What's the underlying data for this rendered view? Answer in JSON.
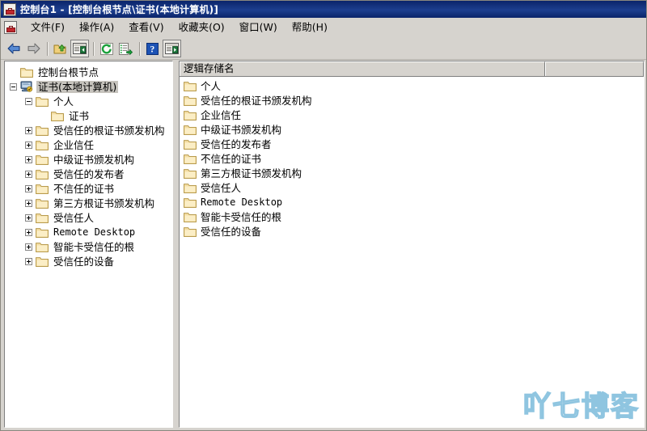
{
  "window": {
    "title": "控制台1 - [控制台根节点\\证书(本地计算机)]",
    "icon": "mmc-console-icon",
    "titlebar_color": "#0a246a",
    "chrome_color": "#d6d3ce"
  },
  "menu": {
    "items": [
      {
        "label": "文件(F)",
        "name": "menu-file"
      },
      {
        "label": "操作(A)",
        "name": "menu-action"
      },
      {
        "label": "查看(V)",
        "name": "menu-view"
      },
      {
        "label": "收藏夹(O)",
        "name": "menu-favorites"
      },
      {
        "label": "窗口(W)",
        "name": "menu-window"
      },
      {
        "label": "帮助(H)",
        "name": "menu-help"
      }
    ]
  },
  "toolbar": {
    "buttons": [
      {
        "icon": "back-arrow-icon",
        "enabled": true
      },
      {
        "icon": "forward-arrow-icon",
        "enabled": false
      },
      {
        "icon": "up-one-level-folder-icon",
        "enabled": true
      },
      {
        "icon": "show-hide-console-tree-icon",
        "enabled": true
      },
      {
        "icon": "refresh-icon",
        "enabled": true
      },
      {
        "icon": "export-list-icon",
        "enabled": true
      },
      {
        "icon": "help-icon",
        "enabled": true
      },
      {
        "icon": "properties-view-icon",
        "enabled": true
      }
    ]
  },
  "tree": {
    "nodes": [
      {
        "label": "控制台根节点",
        "depth": 0,
        "expander": "none",
        "icon": "folder-icon",
        "selected": false
      },
      {
        "label": "证书(本地计算机)",
        "depth": 0,
        "expander": "minus",
        "icon": "certificates-computer-icon",
        "selected": true
      },
      {
        "label": "个人",
        "depth": 1,
        "expander": "minus",
        "icon": "folder-icon",
        "selected": false
      },
      {
        "label": "证书",
        "depth": 2,
        "expander": "none",
        "icon": "folder-icon",
        "selected": false
      },
      {
        "label": "受信任的根证书颁发机构",
        "depth": 1,
        "expander": "plus",
        "icon": "folder-icon",
        "selected": false
      },
      {
        "label": "企业信任",
        "depth": 1,
        "expander": "plus",
        "icon": "folder-icon",
        "selected": false
      },
      {
        "label": "中级证书颁发机构",
        "depth": 1,
        "expander": "plus",
        "icon": "folder-icon",
        "selected": false
      },
      {
        "label": "受信任的发布者",
        "depth": 1,
        "expander": "plus",
        "icon": "folder-icon",
        "selected": false
      },
      {
        "label": "不信任的证书",
        "depth": 1,
        "expander": "plus",
        "icon": "folder-icon",
        "selected": false
      },
      {
        "label": "第三方根证书颁发机构",
        "depth": 1,
        "expander": "plus",
        "icon": "folder-icon",
        "selected": false
      },
      {
        "label": "受信任人",
        "depth": 1,
        "expander": "plus",
        "icon": "folder-icon",
        "selected": false
      },
      {
        "label": "Remote Desktop",
        "depth": 1,
        "expander": "plus",
        "icon": "folder-icon",
        "selected": false,
        "mono": true
      },
      {
        "label": "智能卡受信任的根",
        "depth": 1,
        "expander": "plus",
        "icon": "folder-icon",
        "selected": false
      },
      {
        "label": "受信任的设备",
        "depth": 1,
        "expander": "plus",
        "icon": "folder-icon",
        "selected": false
      }
    ]
  },
  "list": {
    "columns": [
      {
        "label": "逻辑存储名",
        "name": "column-logical-store-name"
      },
      {
        "label": "",
        "name": "column-blank"
      }
    ],
    "rows": [
      {
        "label": "个人",
        "icon": "folder-icon"
      },
      {
        "label": "受信任的根证书颁发机构",
        "icon": "folder-icon"
      },
      {
        "label": "企业信任",
        "icon": "folder-icon"
      },
      {
        "label": "中级证书颁发机构",
        "icon": "folder-icon"
      },
      {
        "label": "受信任的发布者",
        "icon": "folder-icon"
      },
      {
        "label": "不信任的证书",
        "icon": "folder-icon"
      },
      {
        "label": "第三方根证书颁发机构",
        "icon": "folder-icon"
      },
      {
        "label": "受信任人",
        "icon": "folder-icon"
      },
      {
        "label": "Remote Desktop",
        "icon": "folder-icon",
        "mono": true
      },
      {
        "label": "智能卡受信任的根",
        "icon": "folder-icon"
      },
      {
        "label": "受信任的设备",
        "icon": "folder-icon"
      }
    ]
  },
  "watermark": {
    "text": "吖七博客",
    "color": "#8fc5e0"
  }
}
